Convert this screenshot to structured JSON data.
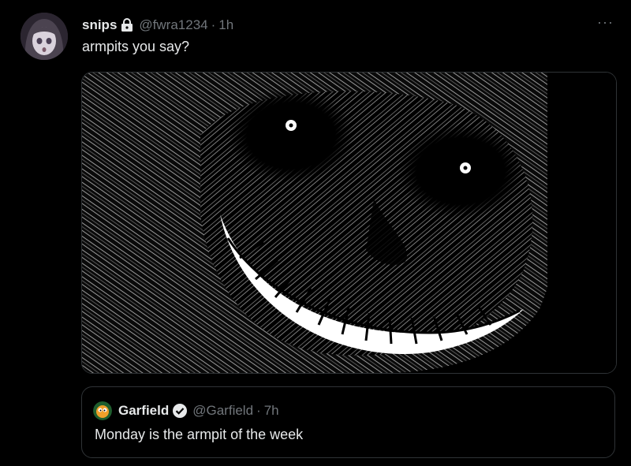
{
  "tweet": {
    "display_name": "snips",
    "handle": "@fwra1234",
    "separator": "·",
    "time": "1h",
    "text": "armpits you say?",
    "locked_icon": "lock-icon",
    "more_icon": "more-icon",
    "more_symbol": "···"
  },
  "quoted_tweet": {
    "display_name": "Garfield",
    "handle": "@Garfield",
    "separator": "·",
    "time": "7h",
    "text": "Monday is the armpit of the week",
    "verified_icon": "verified-badge-icon"
  },
  "colors": {
    "background": "#000000",
    "primary_text": "#e7e9ea",
    "secondary_text": "#71767b",
    "border": "#2f3336"
  }
}
